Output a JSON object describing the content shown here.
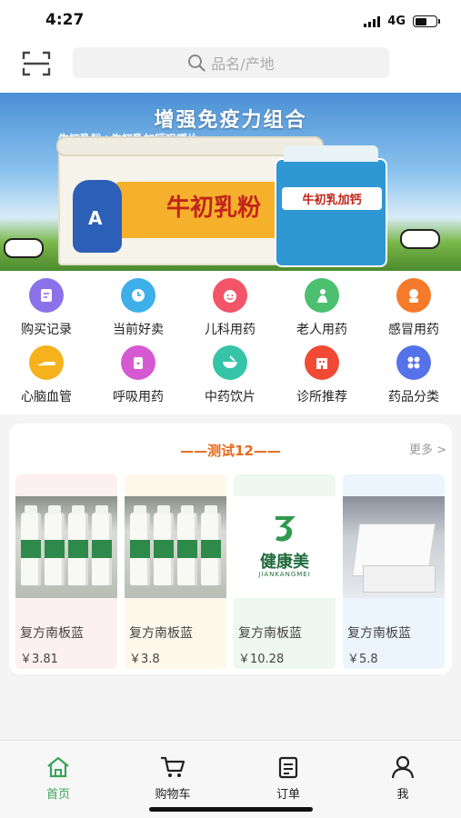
{
  "status_bar": {
    "time": "4:27",
    "network": "4G"
  },
  "search": {
    "placeholder": "品名/产地"
  },
  "banner": {
    "title": "增强免疫力组合",
    "subtitle": "牛初乳粉+牛初乳加钙咀嚼片",
    "product_big": "牛初乳粉",
    "product_small": "牛初乳加钙"
  },
  "categories": [
    {
      "label": "购买记录",
      "icon": "receipt-icon",
      "color": "#8c72e8"
    },
    {
      "label": "当前好卖",
      "icon": "clock-icon",
      "color": "#3db0ea"
    },
    {
      "label": "儿科用药",
      "icon": "child-face-icon",
      "color": "#f25568"
    },
    {
      "label": "老人用药",
      "icon": "elder-icon",
      "color": "#4cc070"
    },
    {
      "label": "感冒用药",
      "icon": "cold-icon",
      "color": "#f57b2a"
    },
    {
      "label": "心脑血管",
      "icon": "heart-vessel-icon",
      "color": "#f5b21d"
    },
    {
      "label": "呼吸用药",
      "icon": "respiratory-icon",
      "color": "#d559d2"
    },
    {
      "label": "中药饮片",
      "icon": "herbal-bowl-icon",
      "color": "#35c4a8"
    },
    {
      "label": "诊所推荐",
      "icon": "clinic-icon",
      "color": "#f04a35"
    },
    {
      "label": "药品分类",
      "icon": "grid-icon",
      "color": "#5672ea"
    }
  ],
  "section": {
    "title": "——测试12——",
    "more": "更多 >",
    "products": [
      {
        "name": "复方南板蓝",
        "price": "￥3.81",
        "bg": "#fdf0f0",
        "image": "bottles"
      },
      {
        "name": "复方南板蓝",
        "price": "￥3.8",
        "bg": "#fdf8ea",
        "image": "bottles"
      },
      {
        "name": "复方南板蓝",
        "price": "￥10.28",
        "bg": "#eef8f0",
        "image": "logo",
        "logo_text": "健康美",
        "logo_sub": "JIANKANGMEI"
      },
      {
        "name": "复方南板蓝",
        "price": "￥5.8",
        "bg": "#ecf5fd",
        "image": "box"
      }
    ]
  },
  "tabbar": [
    {
      "label": "首页",
      "icon": "home-icon",
      "active": true
    },
    {
      "label": "购物车",
      "icon": "cart-icon",
      "active": false
    },
    {
      "label": "订单",
      "icon": "order-icon",
      "active": false
    },
    {
      "label": "我",
      "icon": "user-icon",
      "active": false
    }
  ],
  "colors": {
    "accent": "#3aa35a",
    "section_title": "#e56a1c"
  }
}
